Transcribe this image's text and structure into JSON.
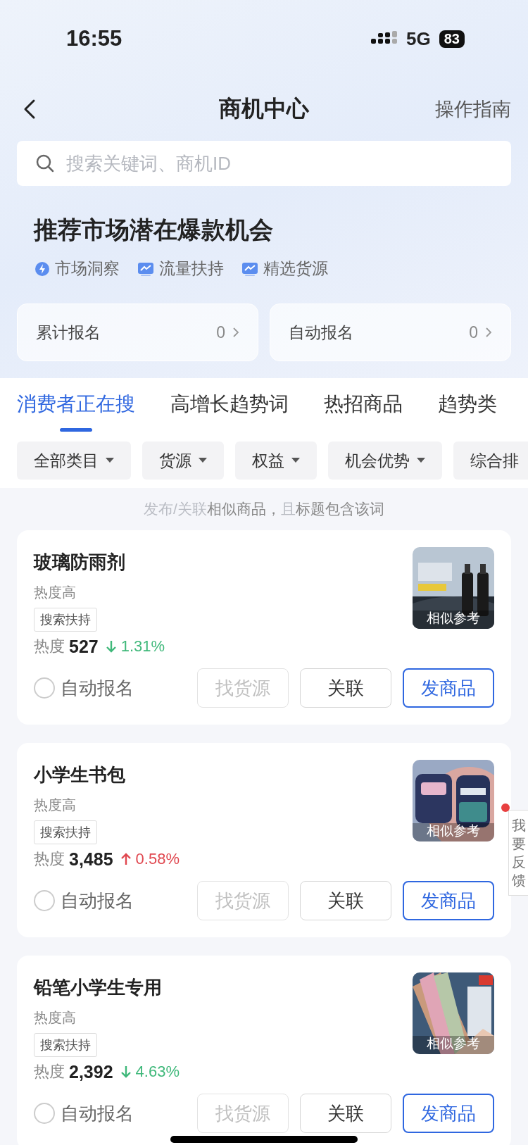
{
  "status_bar": {
    "time": "16:55",
    "network": "5G",
    "battery": "83"
  },
  "nav": {
    "title": "商机中心",
    "action": "操作指南"
  },
  "search": {
    "placeholder": "搜索关键词、商机ID"
  },
  "headline": "推荐市场潜在爆款机会",
  "features": [
    {
      "label": "市场洞察",
      "kind": "bolt"
    },
    {
      "label": "流量扶持",
      "kind": "chart"
    },
    {
      "label": "精选货源",
      "kind": "chart"
    }
  ],
  "stats": [
    {
      "label": "累计报名",
      "value": "0"
    },
    {
      "label": "自动报名",
      "value": "0"
    }
  ],
  "tabs": [
    {
      "label": "消费者正在搜",
      "selected": true
    },
    {
      "label": "高增长趋势词",
      "selected": false
    },
    {
      "label": "热招商品",
      "selected": false
    },
    {
      "label": "趋势类",
      "selected": false
    }
  ],
  "filters": [
    "全部类目",
    "货源",
    "权益",
    "机会优势",
    "综合排"
  ],
  "hint": [
    {
      "text": "发布/关联",
      "muted": true
    },
    {
      "text": "相似商品，",
      "muted": false
    },
    {
      "text": "且",
      "muted": true
    },
    {
      "text": "标题包含该词",
      "muted": false
    }
  ],
  "items": [
    {
      "title": "玻璃防雨剂",
      "heat_level": "热度高",
      "tag": "搜索扶持",
      "heat_label": "热度",
      "heat": "527",
      "rising": false,
      "change": "1.31%",
      "caption": "相似参考",
      "auto": {
        "label": "自动报名",
        "checked": false
      },
      "buttons": [
        {
          "label": "找货源",
          "kind": "disabled"
        },
        {
          "label": "关联",
          "kind": "normal"
        },
        {
          "label": "发商品",
          "kind": "primary"
        }
      ]
    },
    {
      "title": "小学生书包",
      "heat_level": "热度高",
      "tag": "搜索扶持",
      "heat_label": "热度",
      "heat": "3,485",
      "rising": true,
      "change": "0.58%",
      "caption": "相似参考",
      "auto": {
        "label": "自动报名",
        "checked": false
      },
      "buttons": [
        {
          "label": "找货源",
          "kind": "disabled"
        },
        {
          "label": "关联",
          "kind": "normal"
        },
        {
          "label": "发商品",
          "kind": "primary"
        }
      ]
    },
    {
      "title": "铅笔小学生专用",
      "heat_level": "热度高",
      "tag": "搜索扶持",
      "heat_label": "热度",
      "heat": "2,392",
      "rising": false,
      "change": "4.63%",
      "caption": "相似参考",
      "auto": {
        "label": "自动报名",
        "checked": false
      },
      "buttons": [
        {
          "label": "找货源",
          "kind": "disabled"
        },
        {
          "label": "关联",
          "kind": "normal"
        },
        {
          "label": "发商品",
          "kind": "primary"
        }
      ]
    }
  ],
  "feedback": {
    "label": "我要反馈",
    "badge": true
  }
}
